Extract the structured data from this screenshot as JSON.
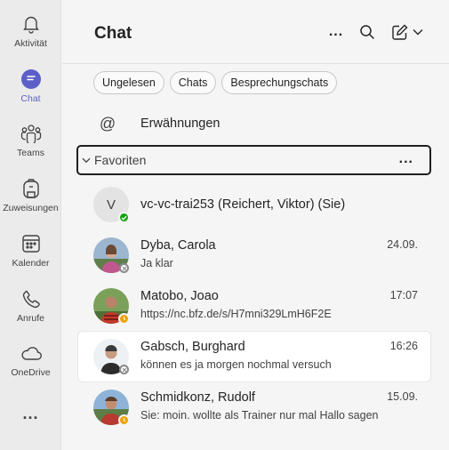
{
  "rail": {
    "items": [
      {
        "label": "Aktivität",
        "icon": "bell-icon"
      },
      {
        "label": "Chat",
        "icon": "chat-icon",
        "active": true
      },
      {
        "label": "Teams",
        "icon": "teams-icon"
      },
      {
        "label": "Zuweisungen",
        "icon": "backpack-icon"
      },
      {
        "label": "Kalender",
        "icon": "calendar-icon"
      },
      {
        "label": "Anrufe",
        "icon": "phone-icon"
      },
      {
        "label": "OneDrive",
        "icon": "cloud-icon"
      }
    ],
    "more": "..."
  },
  "header": {
    "title": "Chat",
    "more": "..."
  },
  "filters": [
    "Ungelesen",
    "Chats",
    "Besprechungschats"
  ],
  "mentions": {
    "symbol": "@",
    "label": "Erwähnungen"
  },
  "favorites": {
    "label": "Favoriten",
    "more": "..."
  },
  "chats": [
    {
      "name": "vc-vc-trai253 (Reichert, Viktor) (Sie)",
      "initial": "V",
      "status": "available",
      "time": "",
      "preview": ""
    },
    {
      "name": "Dyba, Carola",
      "time": "24.09.",
      "preview": "Ja klar",
      "status": "offline"
    },
    {
      "name": "Matobo, Joao",
      "time": "17:07",
      "preview": "https://nc.bfz.de/s/H7mni329LmH6F2E",
      "status": "away"
    },
    {
      "name": "Gabsch, Burghard",
      "time": "16:26",
      "preview": "können es ja morgen nochmal versuch",
      "status": "offline",
      "selected": true
    },
    {
      "name": "Schmidkonz, Rudolf",
      "time": "15.09.",
      "preview": "Sie: moin. wollte als Trainer nur mal Hallo sagen",
      "status": "away"
    }
  ],
  "colors": {
    "accent": "#5b5fc7",
    "available": "#13a10e",
    "away": "#eaa300",
    "offline": "#8a8a8a"
  }
}
